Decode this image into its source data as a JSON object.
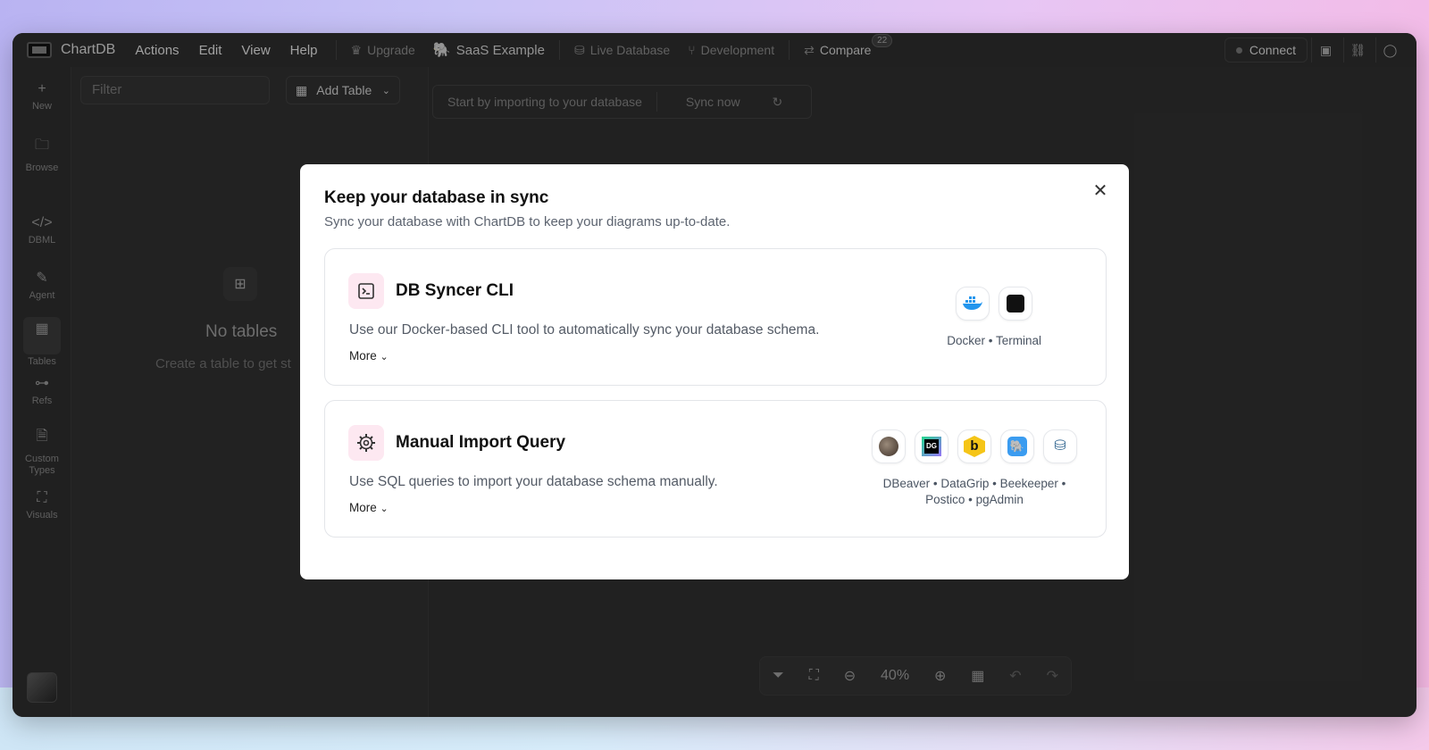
{
  "app": {
    "brand": "ChartDB",
    "menu": [
      "Actions",
      "Edit",
      "View",
      "Help"
    ],
    "upgrade": "Upgrade",
    "project": "SaaS Example",
    "db_label": "Live Database",
    "branch_label": "Development",
    "compare_label": "Compare",
    "compare_badge": "22",
    "connect_label": "Connect"
  },
  "rail": {
    "new": "New",
    "browse": "Browse",
    "dbml": "DBML",
    "agent": "Agent",
    "tables": "Tables",
    "refs": "Refs",
    "custom_types": "Custom Types",
    "visuals": "Visuals"
  },
  "sidepanel": {
    "filter_placeholder": "Filter",
    "add_table": "Add Table",
    "empty_title": "No tables",
    "empty_sub": "Create a table to get st"
  },
  "canvas": {
    "sync_hint": "Start by importing to your database",
    "sync_now": "Sync now",
    "zoom": "40%"
  },
  "modal": {
    "title": "Keep your database in sync",
    "subtitle": "Sync your database with ChartDB to keep your diagrams up-to-date.",
    "cards": [
      {
        "title": "DB Syncer CLI",
        "description": "Use our Docker-based CLI tool to automatically sync your database schema.",
        "more": "More",
        "tools_label": "Docker • Terminal"
      },
      {
        "title": "Manual Import Query",
        "description": "Use SQL queries to import your database schema manually.",
        "more": "More",
        "tools_line1": "DBeaver • DataGrip • Beekeeper •",
        "tools_line2": "Postico • pgAdmin"
      }
    ]
  },
  "colors": {
    "accent_pink": "#fde8f1",
    "docker_blue": "#2496ed",
    "beekeeper_yellow": "#f5c518"
  }
}
